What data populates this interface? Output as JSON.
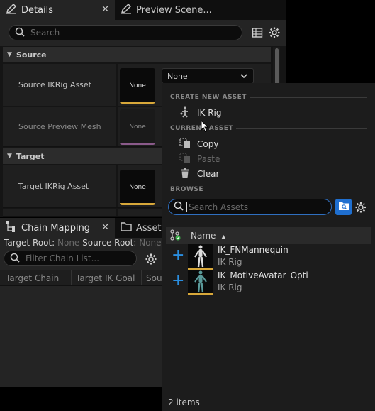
{
  "details_tabs": [
    {
      "label": "Details"
    },
    {
      "label": "Preview Scene..."
    }
  ],
  "details": {
    "search_placeholder": "Search",
    "sections": [
      {
        "title": "Source",
        "rows": [
          {
            "label": "Source IKRig Asset",
            "thumb_text": "None",
            "value": "None"
          },
          {
            "label": "Source Preview Mesh",
            "thumb_text": "None"
          }
        ]
      },
      {
        "title": "Target",
        "rows": [
          {
            "label": "Target IKRig Asset",
            "thumb_text": "None"
          }
        ]
      }
    ]
  },
  "chain_tabs": [
    {
      "label": "Chain Mapping"
    },
    {
      "label": "Asset"
    }
  ],
  "chain": {
    "target_root_label": "Target Root:",
    "target_root_value": "None",
    "source_root_label": "Source Root:",
    "source_root_value": "None",
    "filter_placeholder": "Filter Chain List...",
    "columns": [
      "Target Chain",
      "Target IK Goal",
      "Sou"
    ]
  },
  "popup": {
    "create_header": "CREATE NEW ASSET",
    "create_items": [
      {
        "label": "IK Rig"
      }
    ],
    "current_header": "CURRENT ASSET",
    "current_items": [
      {
        "label": "Copy",
        "enabled": true
      },
      {
        "label": "Paste",
        "enabled": false
      },
      {
        "label": "Clear",
        "enabled": true
      }
    ],
    "browse_header": "BROWSE",
    "search_placeholder": "Search Assets",
    "column_name": "Name",
    "assets": [
      {
        "name": "IK_FNMannequin",
        "type": "IK Rig"
      },
      {
        "name": "IK_MotiveAvatar_Opti",
        "type": "IK Rig"
      }
    ],
    "footer": "2 items"
  },
  "colors": {
    "accent_blue": "#1f6fd0",
    "asset_bar": "#d8a83a",
    "add_icon": "#2a8ee0"
  }
}
